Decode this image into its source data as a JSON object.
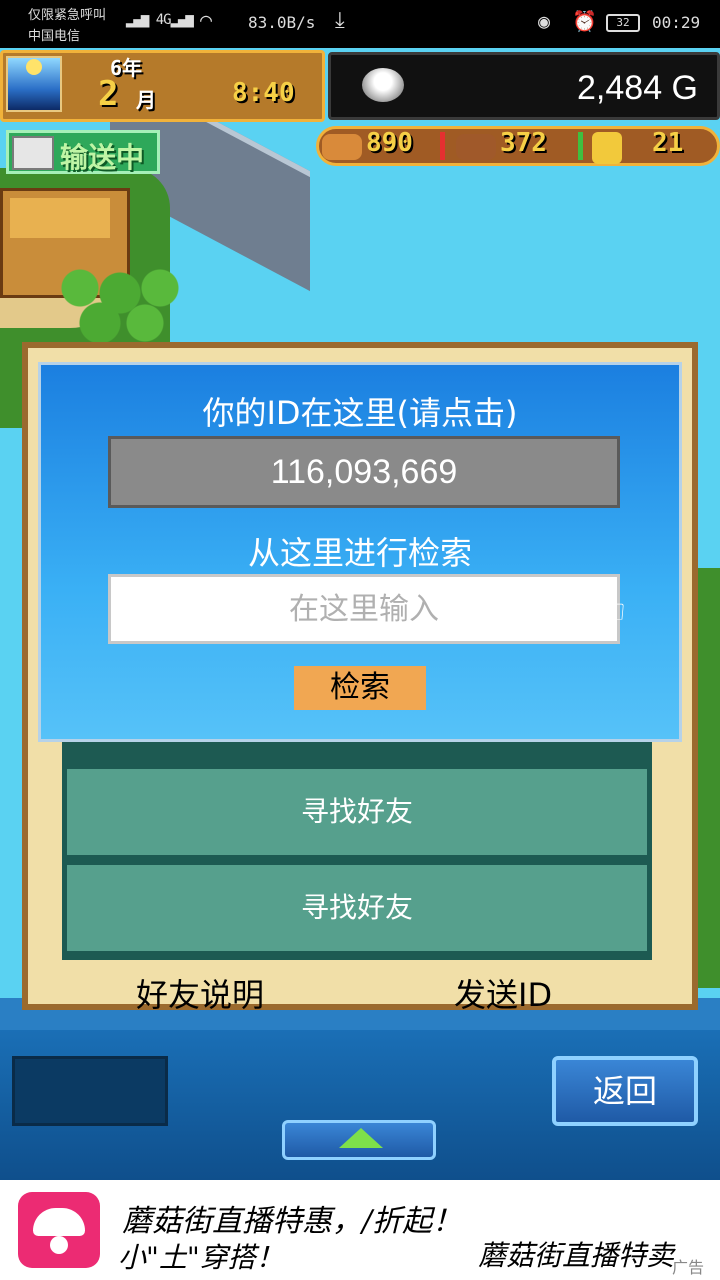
{
  "status_bar": {
    "carrier_top": "仅限紧急呼叫",
    "carrier_bottom": "中国电信",
    "signal": "4G",
    "net_speed": "83.0B/s",
    "battery": "32",
    "time": "00:29"
  },
  "hud": {
    "year": "6年",
    "month_num": "2",
    "month_unit": "月",
    "clock": "8:40",
    "gold": "2,484 G",
    "resources": [
      {
        "name": "food",
        "value": "890",
        "color": "#d98a3a"
      },
      {
        "name": "wood",
        "value": "372",
        "color": "#a0592a"
      },
      {
        "name": "medal",
        "value": "21",
        "color": "#f2c93b"
      }
    ],
    "transport_label": "输送中"
  },
  "background_window": {
    "friend_buttons": [
      "寻找好友",
      "寻找好友"
    ],
    "footer_left": "好友说明",
    "footer_right": "发送ID"
  },
  "dialog": {
    "title": "你的ID在这里(请点击)",
    "player_id": "116,093,669",
    "search_label": "从这里进行检索",
    "search_placeholder": "在这里输入",
    "search_button": "检索"
  },
  "bottom_nav": {
    "return_button": "返回"
  },
  "ad": {
    "line1": "蘑菇街直播特惠，/折起！",
    "line2": "小\"土\"穿搭！",
    "line3": "蘑菇街直播特卖",
    "tag": "广告"
  },
  "colors": {
    "dialog_blue": "#1b7fe0",
    "search_button": "#f1a752",
    "friend_button": "#56a08d",
    "ad_logo": "#ec2b73"
  }
}
